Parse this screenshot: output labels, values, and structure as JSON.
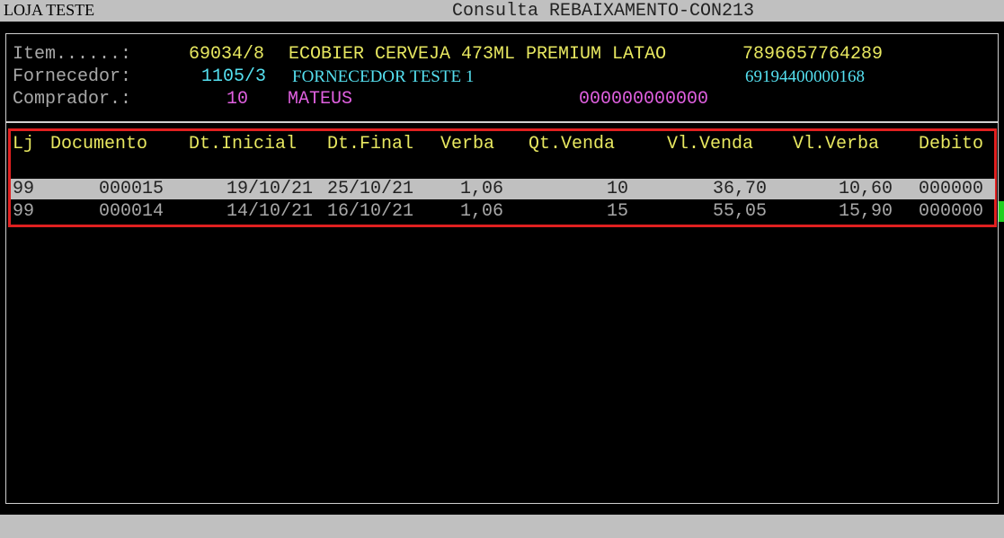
{
  "window": {
    "store_name": "LOJA TESTE",
    "title": "Consulta REBAIXAMENTO-CON213"
  },
  "header": {
    "item_label": "Item......:",
    "item_code": "69034/8",
    "item_description": "ECOBIER CERVEJA 473ML PREMIUM LATAO",
    "item_ean": "7896657764289",
    "supplier_label": "Fornecedor:",
    "supplier_code": "1105/3",
    "supplier_name": "FORNECEDOR TESTE 1",
    "supplier_cnpj": "69194400000168",
    "buyer_label": "Comprador.:",
    "buyer_code": "10",
    "buyer_name": "MATEUS",
    "buyer_extra": "000000000000"
  },
  "table": {
    "columns": [
      "Lj",
      "Documento",
      "Dt.Inicial",
      "Dt.Final",
      "Verba",
      "Qt.Venda",
      "Vl.Venda",
      "Vl.Verba",
      "Debito"
    ],
    "rows": [
      {
        "lj": "99",
        "documento": "000015",
        "dt_inicial": "19/10/21",
        "dt_final": "25/10/21",
        "verba": "1,06",
        "qt_venda": "10",
        "vl_venda": "36,70",
        "vl_verba": "10,60",
        "debito": "000000"
      },
      {
        "lj": "99",
        "documento": "000014",
        "dt_inicial": "14/10/21",
        "dt_final": "16/10/21",
        "verba": "1,06",
        "qt_venda": "15",
        "vl_venda": "55,05",
        "vl_verba": "15,90",
        "debito": "000000"
      }
    ]
  },
  "colors": {
    "background": "#000000",
    "label": "#a8a8a8",
    "value": "#e8e860",
    "supplier": "#55e0f0",
    "buyer": "#e060e0",
    "highlight_box": "#e02020",
    "selected_row": "#c0c0c0"
  }
}
